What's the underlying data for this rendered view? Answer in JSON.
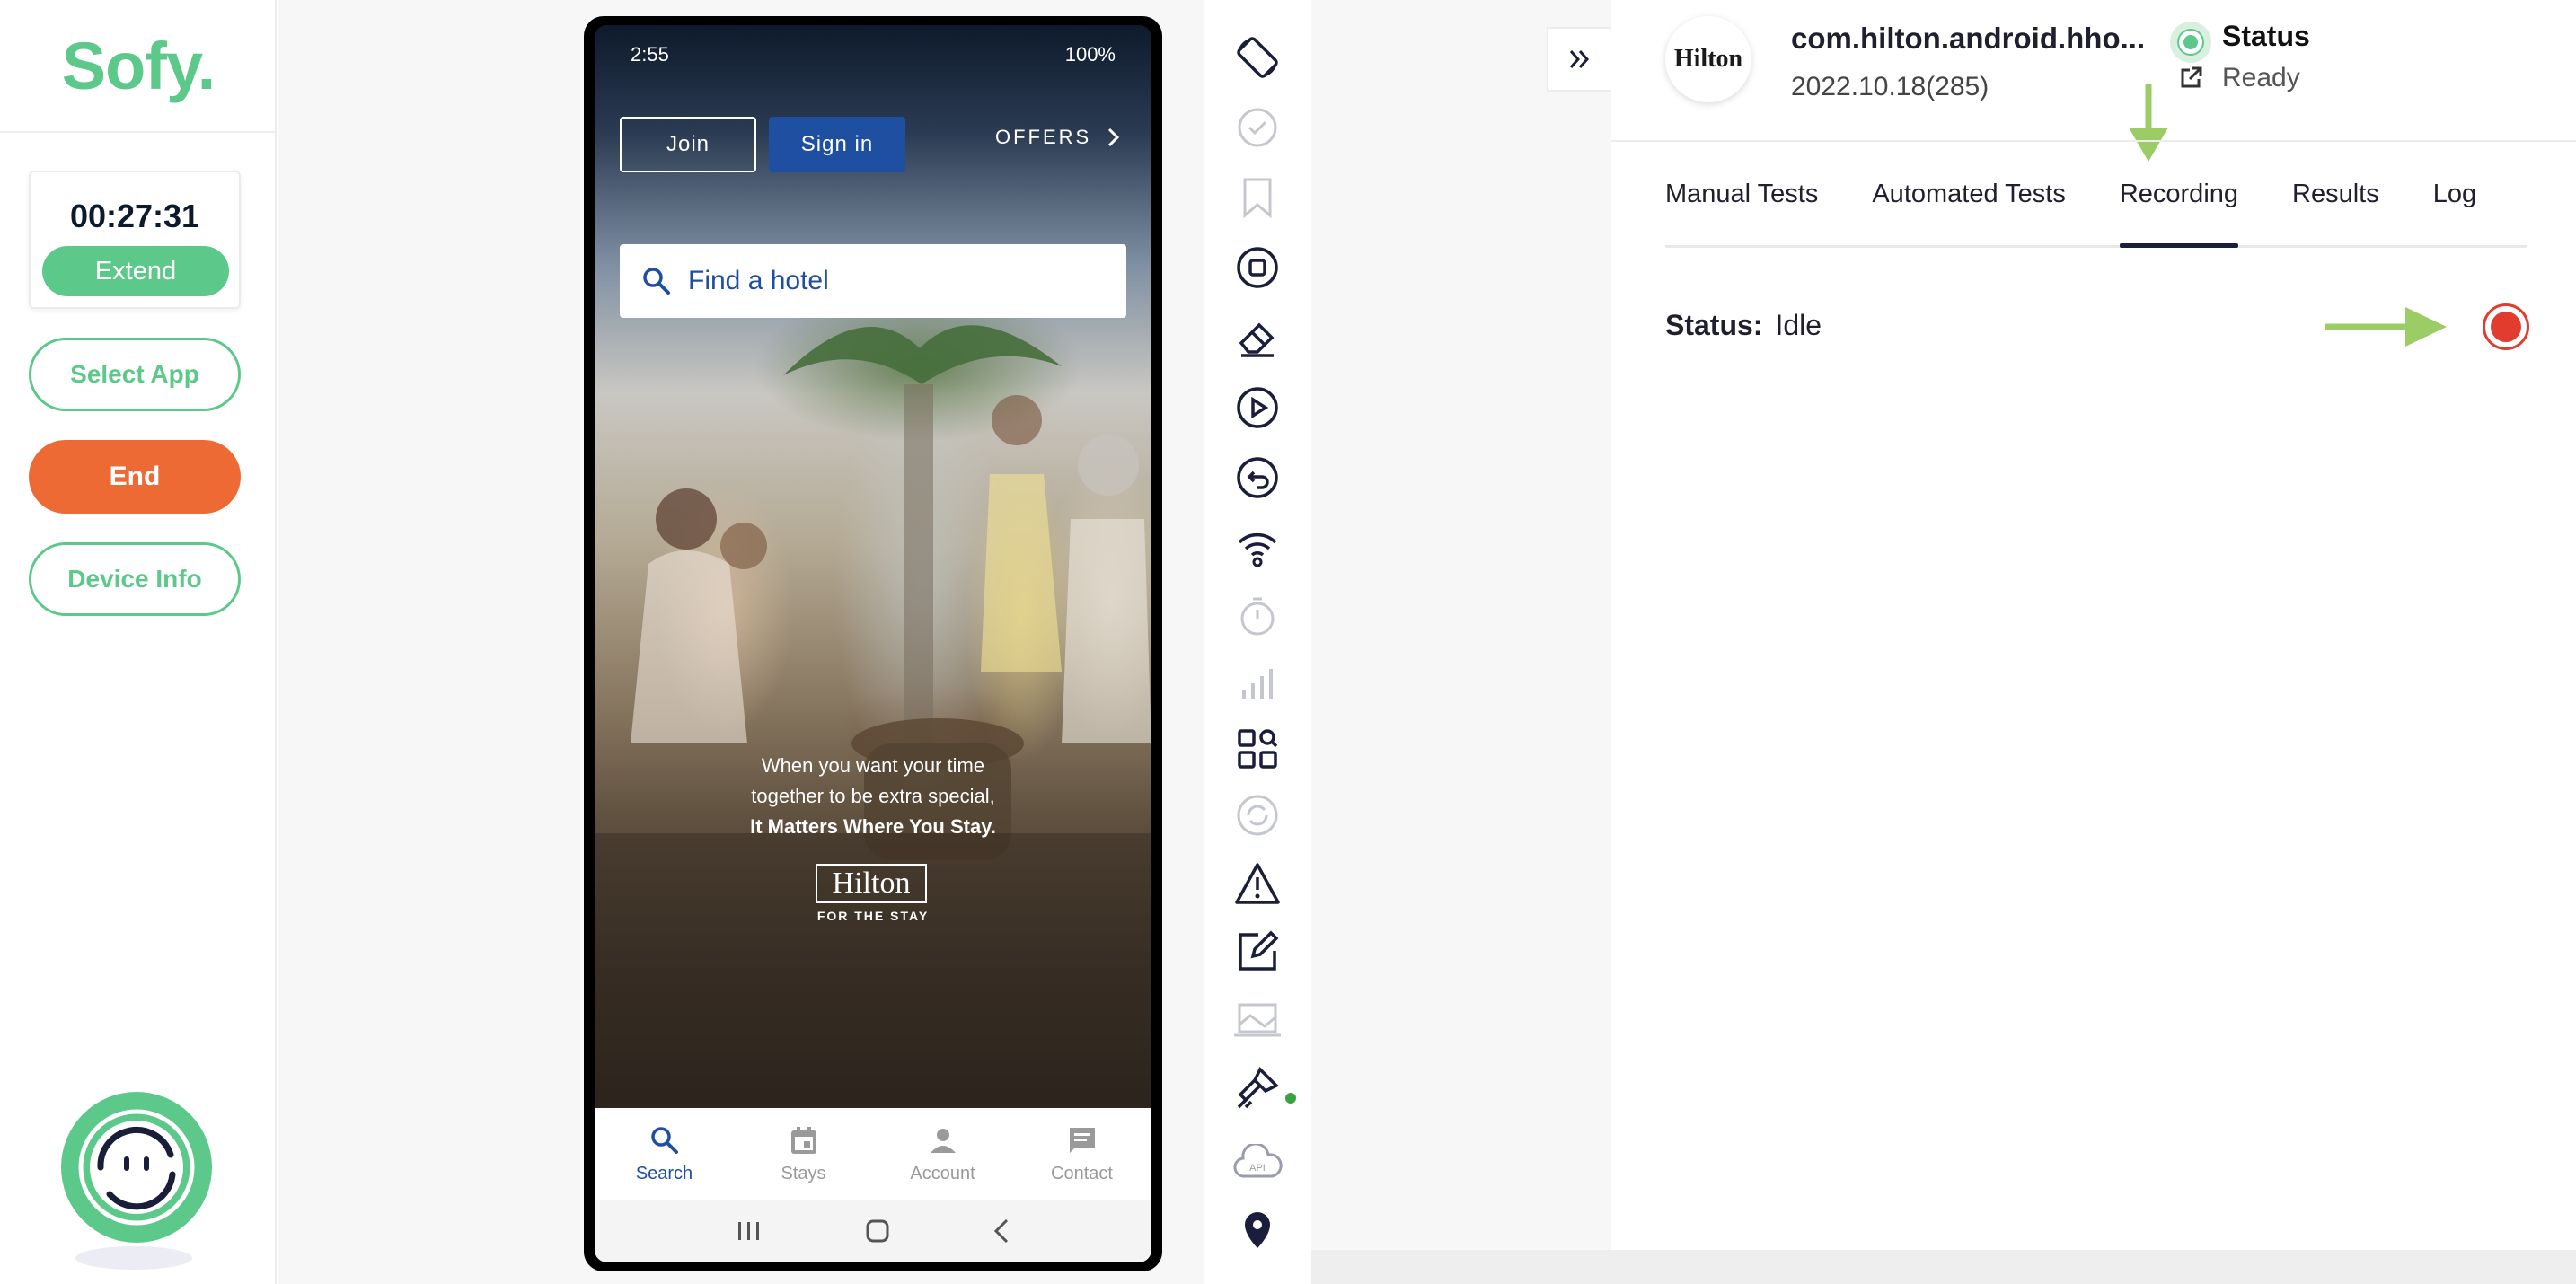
{
  "sidebar": {
    "logo": "Sofy.",
    "timer": "00:27:31",
    "extend_label": "Extend",
    "select_app_label": "Select App",
    "end_label": "End",
    "device_info_label": "Device Info"
  },
  "phone": {
    "status_time": "2:55",
    "status_right": "100%",
    "join_label": "Join",
    "signin_label": "Sign in",
    "offers_label": "OFFERS",
    "search_placeholder": "Find a hotel",
    "tagline_line1": "When you want your time",
    "tagline_line2": "together to be extra special,",
    "tagline_line3": "It Matters Where You Stay.",
    "brand": "Hilton",
    "brand_sub": "FOR THE STAY",
    "tabs": [
      {
        "label": "Search",
        "icon": "search-icon"
      },
      {
        "label": "Stays",
        "icon": "calendar-icon"
      },
      {
        "label": "Account",
        "icon": "person-icon"
      },
      {
        "label": "Contact",
        "icon": "chat-icon"
      }
    ]
  },
  "panel": {
    "app_logo_text": "Hilton",
    "app_name": "com.hilton.android.hho...",
    "app_version": "2022.10.18(285)",
    "status_label": "Status",
    "status_value": "Ready",
    "tabs": [
      "Manual Tests",
      "Automated Tests",
      "Recording",
      "Results",
      "Log"
    ],
    "active_tab": "Recording",
    "recording_status_key": "Status:",
    "recording_status_value": "Idle"
  },
  "colors": {
    "brand_green": "#5cc98a",
    "end_orange": "#ee6a34",
    "record_red": "#e23c2f",
    "hilton_blue": "#1f4fa0",
    "annotation_arrow": "#9ccc65"
  }
}
